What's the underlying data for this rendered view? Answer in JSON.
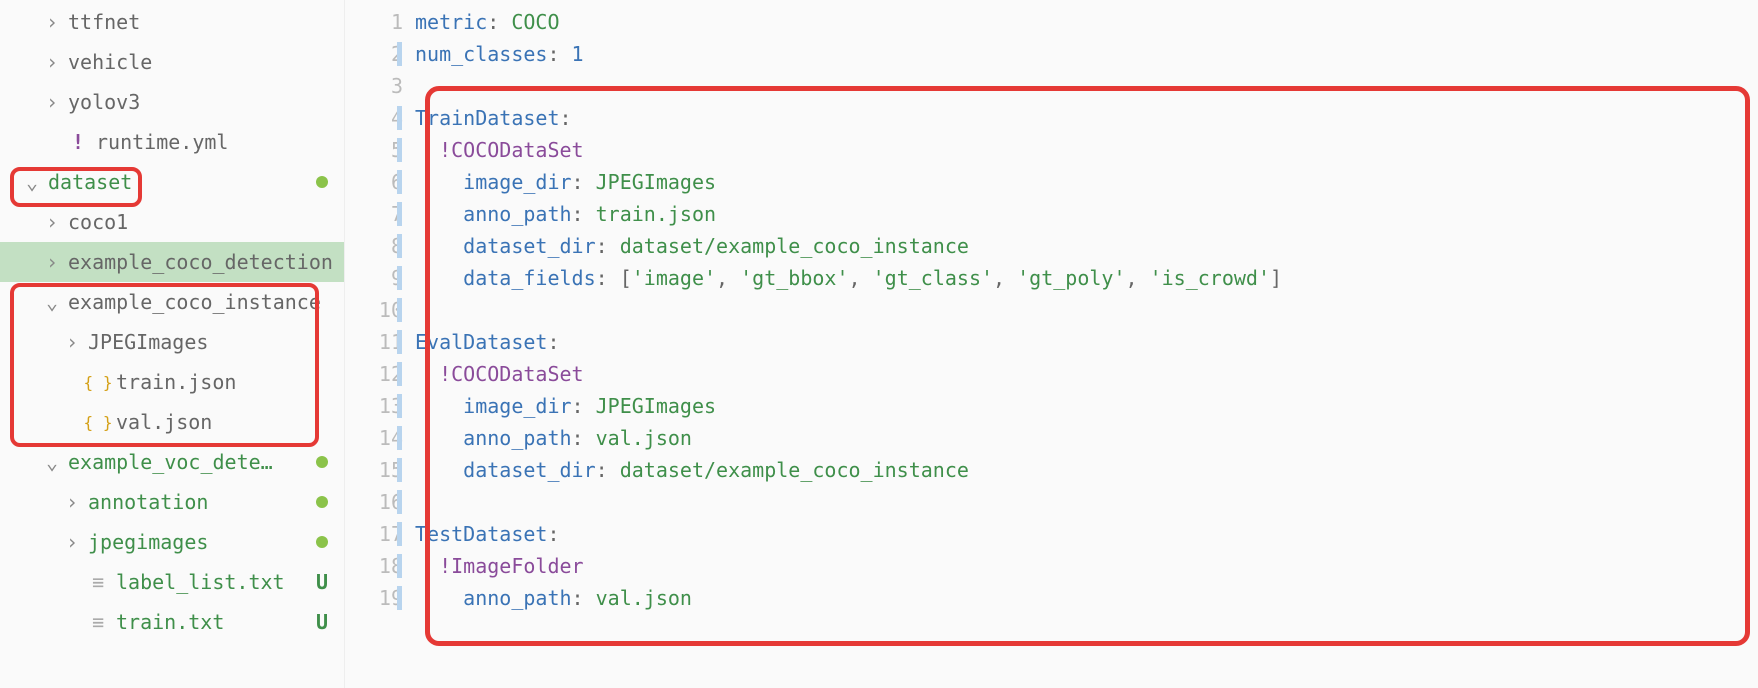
{
  "tree": {
    "items": [
      {
        "label": "ttfnet",
        "indent": 1,
        "chev": "right",
        "green": false,
        "dot": false,
        "letter": "",
        "icon": ""
      },
      {
        "label": "vehicle",
        "indent": 1,
        "chev": "right",
        "green": false,
        "dot": false,
        "letter": "",
        "icon": ""
      },
      {
        "label": "yolov3",
        "indent": 1,
        "chev": "right",
        "green": false,
        "dot": false,
        "letter": "",
        "icon": ""
      },
      {
        "label": "runtime.yml",
        "indent": 1,
        "chev": "",
        "green": false,
        "dot": false,
        "letter": "",
        "icon": "bang"
      },
      {
        "label": "dataset",
        "indent": 0,
        "chev": "down",
        "green": true,
        "dot": true,
        "letter": "",
        "icon": ""
      },
      {
        "label": "coco1",
        "indent": 1,
        "chev": "right",
        "green": false,
        "dot": false,
        "letter": "",
        "icon": ""
      },
      {
        "label": "example_coco_detection",
        "indent": 1,
        "chev": "right",
        "green": false,
        "dot": false,
        "letter": "",
        "icon": "",
        "highlight": true
      },
      {
        "label": "example_coco_instance",
        "indent": 1,
        "chev": "down",
        "green": false,
        "dot": false,
        "letter": "",
        "icon": ""
      },
      {
        "label": "JPEGImages",
        "indent": 2,
        "chev": "right",
        "green": false,
        "dot": false,
        "letter": "",
        "icon": ""
      },
      {
        "label": "train.json",
        "indent": 2,
        "chev": "",
        "green": false,
        "dot": false,
        "letter": "",
        "icon": "json"
      },
      {
        "label": "val.json",
        "indent": 2,
        "chev": "",
        "green": false,
        "dot": false,
        "letter": "",
        "icon": "json"
      },
      {
        "label": "example_voc_dete…",
        "indent": 1,
        "chev": "down",
        "green": true,
        "dot": true,
        "letter": "",
        "icon": ""
      },
      {
        "label": "annotation",
        "indent": 2,
        "chev": "right",
        "green": true,
        "dot": true,
        "letter": "",
        "icon": ""
      },
      {
        "label": "jpegimages",
        "indent": 2,
        "chev": "right",
        "green": true,
        "dot": true,
        "letter": "",
        "icon": ""
      },
      {
        "label": "label_list.txt",
        "indent": 2,
        "chev": "",
        "green": true,
        "dot": false,
        "letter": "U",
        "icon": "txt"
      },
      {
        "label": "train.txt",
        "indent": 2,
        "chev": "",
        "green": true,
        "dot": false,
        "letter": "U",
        "icon": "txt"
      }
    ]
  },
  "code": {
    "lines": [
      {
        "n": 1,
        "bar": false,
        "tokens": [
          [
            "k",
            "metric"
          ],
          [
            "p",
            ": "
          ],
          [
            "s",
            "COCO"
          ]
        ]
      },
      {
        "n": 2,
        "bar": true,
        "tokens": [
          [
            "k",
            "num_classes"
          ],
          [
            "p",
            ": "
          ],
          [
            "n",
            "1"
          ]
        ]
      },
      {
        "n": 3,
        "bar": false,
        "tokens": []
      },
      {
        "n": 4,
        "bar": true,
        "tokens": [
          [
            "k",
            "TrainDataset"
          ],
          [
            "p",
            ":"
          ]
        ]
      },
      {
        "n": 5,
        "bar": true,
        "tokens": [
          [
            "p",
            "  "
          ],
          [
            "tag",
            "!COCODataSet"
          ]
        ]
      },
      {
        "n": 6,
        "bar": true,
        "tokens": [
          [
            "p",
            "    "
          ],
          [
            "k",
            "image_dir"
          ],
          [
            "p",
            ": "
          ],
          [
            "s",
            "JPEGImages"
          ]
        ]
      },
      {
        "n": 7,
        "bar": true,
        "tokens": [
          [
            "p",
            "    "
          ],
          [
            "k",
            "anno_path"
          ],
          [
            "p",
            ": "
          ],
          [
            "s",
            "train.json"
          ]
        ]
      },
      {
        "n": 8,
        "bar": true,
        "tokens": [
          [
            "p",
            "    "
          ],
          [
            "k",
            "dataset_dir"
          ],
          [
            "p",
            ": "
          ],
          [
            "s",
            "dataset/example_coco_instance"
          ]
        ]
      },
      {
        "n": 9,
        "bar": true,
        "tokens": [
          [
            "p",
            "    "
          ],
          [
            "k",
            "data_fields"
          ],
          [
            "p",
            ": ["
          ],
          [
            "s",
            "'image'"
          ],
          [
            "p",
            ", "
          ],
          [
            "s",
            "'gt_bbox'"
          ],
          [
            "p",
            ", "
          ],
          [
            "s",
            "'gt_class'"
          ],
          [
            "p",
            ", "
          ],
          [
            "s",
            "'gt_poly'"
          ],
          [
            "p",
            ", "
          ],
          [
            "s",
            "'is_crowd'"
          ],
          [
            "p",
            "]"
          ]
        ]
      },
      {
        "n": 10,
        "bar": true,
        "tokens": []
      },
      {
        "n": 11,
        "bar": true,
        "tokens": [
          [
            "k",
            "EvalDataset"
          ],
          [
            "p",
            ":"
          ]
        ]
      },
      {
        "n": 12,
        "bar": true,
        "tokens": [
          [
            "p",
            "  "
          ],
          [
            "tag",
            "!COCODataSet"
          ]
        ]
      },
      {
        "n": 13,
        "bar": true,
        "tokens": [
          [
            "p",
            "    "
          ],
          [
            "k",
            "image_dir"
          ],
          [
            "p",
            ": "
          ],
          [
            "s",
            "JPEGImages"
          ]
        ]
      },
      {
        "n": 14,
        "bar": true,
        "tokens": [
          [
            "p",
            "    "
          ],
          [
            "k",
            "anno_path"
          ],
          [
            "p",
            ": "
          ],
          [
            "s",
            "val.json"
          ]
        ]
      },
      {
        "n": 15,
        "bar": true,
        "tokens": [
          [
            "p",
            "    "
          ],
          [
            "k",
            "dataset_dir"
          ],
          [
            "p",
            ": "
          ],
          [
            "s",
            "dataset/example_coco_instance"
          ]
        ]
      },
      {
        "n": 16,
        "bar": true,
        "tokens": []
      },
      {
        "n": 17,
        "bar": true,
        "tokens": [
          [
            "k",
            "TestDataset"
          ],
          [
            "p",
            ":"
          ]
        ]
      },
      {
        "n": 18,
        "bar": true,
        "tokens": [
          [
            "p",
            "  "
          ],
          [
            "tag",
            "!ImageFolder"
          ]
        ]
      },
      {
        "n": 19,
        "bar": true,
        "tokens": [
          [
            "p",
            "    "
          ],
          [
            "k",
            "anno_path"
          ],
          [
            "p",
            ": "
          ],
          [
            "s",
            "val.json"
          ]
        ]
      }
    ]
  },
  "icons": {
    "chev_right": "›",
    "chev_down": "⌄",
    "bang": "!",
    "json": "{ }",
    "txt": "≡"
  }
}
